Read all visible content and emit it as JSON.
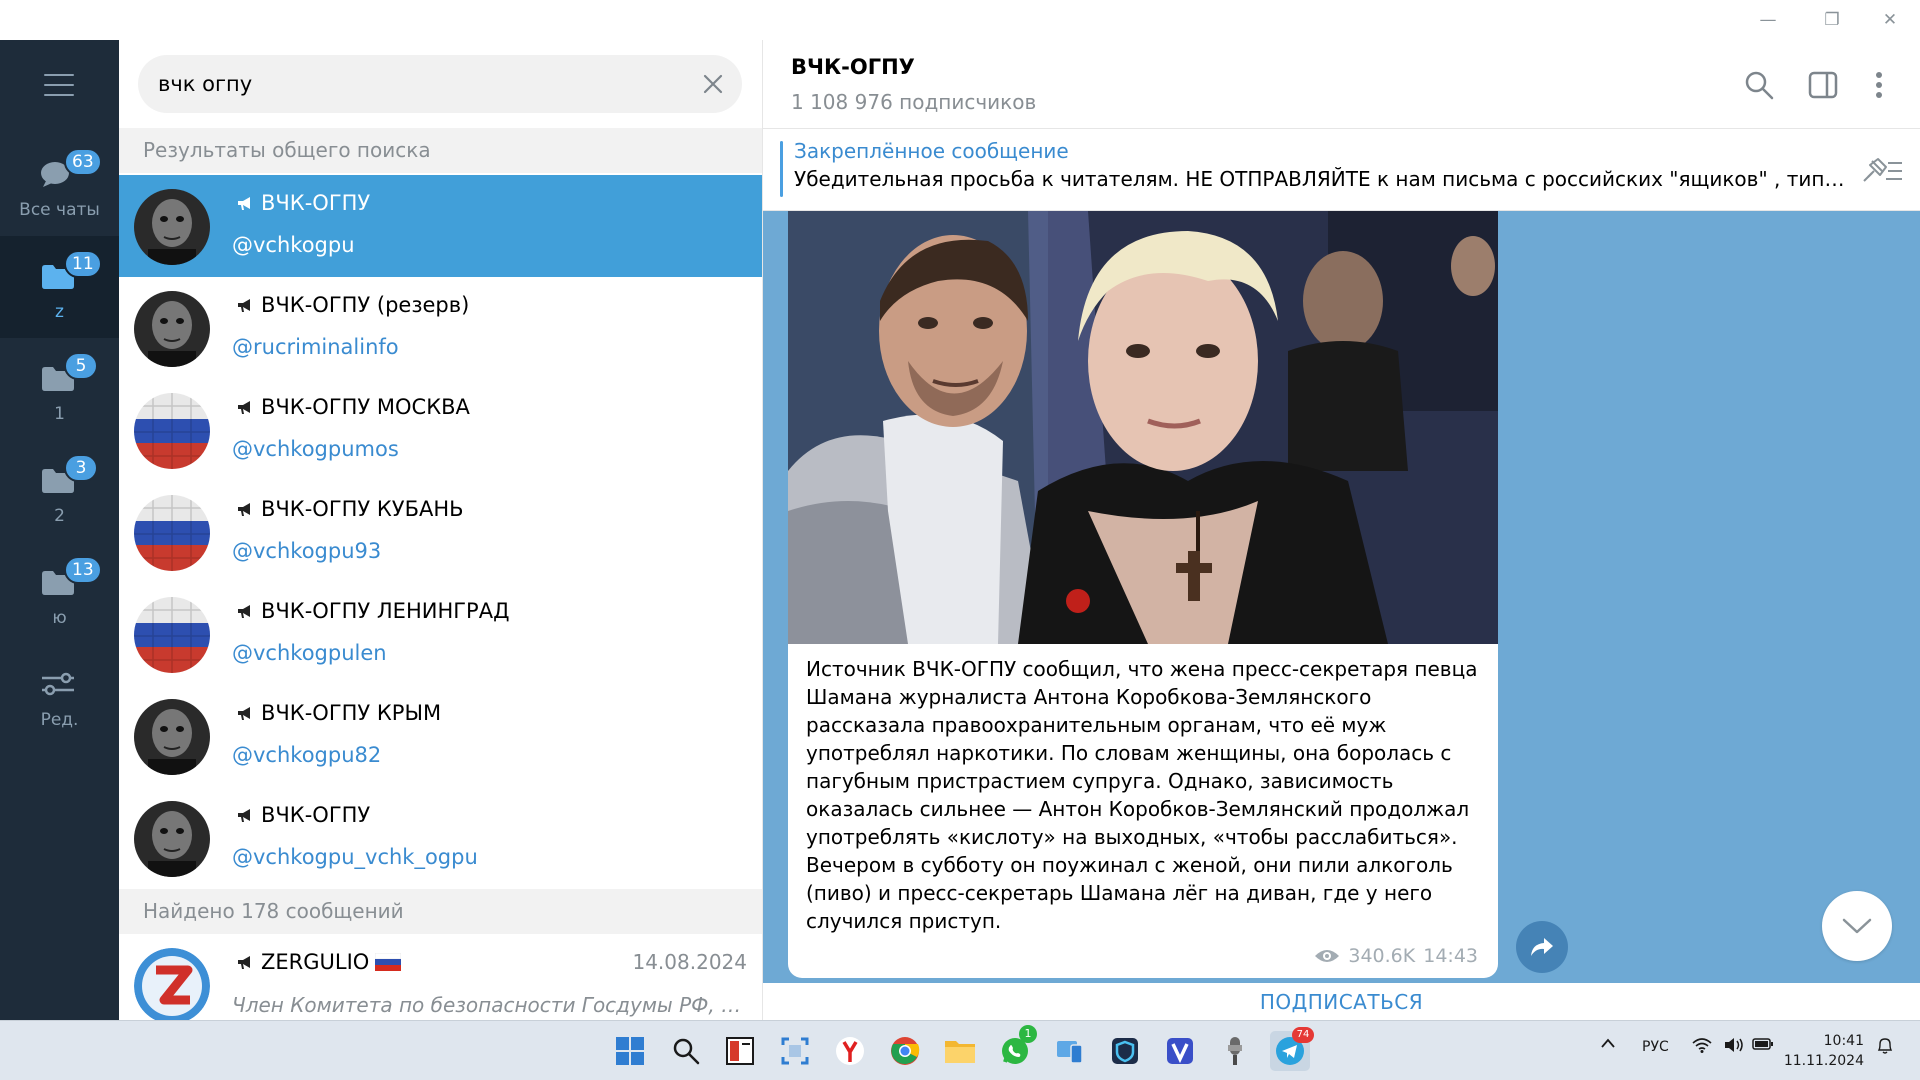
{
  "window": {
    "minimize_glyph": "—",
    "restore_glyph": "❐",
    "close_glyph": "✕"
  },
  "folders": [
    {
      "name": "Все чаты",
      "badge": "63",
      "icon": "chat-bubbles-icon"
    },
    {
      "name": "z",
      "badge": "11",
      "icon": "folder-icon",
      "active": true
    },
    {
      "name": "1",
      "badge": "5",
      "icon": "folder-icon"
    },
    {
      "name": "2",
      "badge": "3",
      "icon": "folder-icon"
    },
    {
      "name": "ю",
      "badge": "13",
      "icon": "folder-icon"
    },
    {
      "name": "Ред.",
      "icon": "sliders-icon"
    }
  ],
  "search": {
    "value": "вчк огпу",
    "global_section": "Результаты общего поиска",
    "messages_section": "Найдено 178 сообщений"
  },
  "results": [
    {
      "title": "ВЧК-ОГПУ",
      "username": "@vchkogpu",
      "avatar": "face",
      "selected": true
    },
    {
      "title": "ВЧК-ОГПУ (резерв)",
      "username": "@rucriminalinfo",
      "avatar": "face"
    },
    {
      "title": "ВЧК-ОГПУ МОСКВА",
      "username": "@vchkogpumos",
      "avatar": "flag"
    },
    {
      "title": "ВЧК-ОГПУ КУБАНЬ",
      "username": "@vchkogpu93",
      "avatar": "flag"
    },
    {
      "title": "ВЧК-ОГПУ ЛЕНИНГРАД",
      "username": "@vchkogpulen",
      "avatar": "flag"
    },
    {
      "title": "ВЧК-ОГПУ КРЫМ",
      "username": "@vchkogpu82",
      "avatar": "face"
    },
    {
      "title": "ВЧК-ОГПУ",
      "username": "@vchkogpu_vchk_ogpu",
      "avatar": "face"
    }
  ],
  "message_result": {
    "title": "ZERGULIO",
    "date": "14.08.2024",
    "preview": "Член Комитета по безопасности Госдумы РФ, депутат"
  },
  "chat": {
    "title": "ВЧК-ОГПУ",
    "subscribers": "1 108 976 подписчиков",
    "pinned_title": "Закреплённое сообщение",
    "pinned_text": "Убедительная просьба к читателям. НЕ ОТПРАВЛЯЙТЕ к нам письма с российских \"ящиков\" , типа ...",
    "message_text": "Источник ВЧК-ОГПУ сообщил, что жена пресс-секретаря певца Шамана журналиста Антона Коробкова-Землянского рассказала правоохранительным органам, что её муж употреблял наркотики. По словам женщины, она боролась с пагубным пристрастием супруга. Однако, зависимость оказалась сильнее — Антон Коробков-Землянский продолжал употреблять «кислоту» на выходных, «чтобы расслабиться». Вечером в субботу он поужинал с женой, они пили алкоголь (пиво) и пресс-секретарь Шамана лёг на диван, где у него случился приступ.",
    "views": "340.6K",
    "time": "14:43",
    "subscribe": "ПОДПИСАТЬСЯ"
  },
  "taskbar": {
    "lang": "РУС",
    "time": "10:41",
    "date": "11.11.2024",
    "whatsapp_badge": "1",
    "telegram_badge": "74"
  },
  "colors": {
    "rail": "#1e2c3a",
    "accent": "#419fd9",
    "wallpaper": "#6ea9d4",
    "link": "#3a8bd0"
  }
}
